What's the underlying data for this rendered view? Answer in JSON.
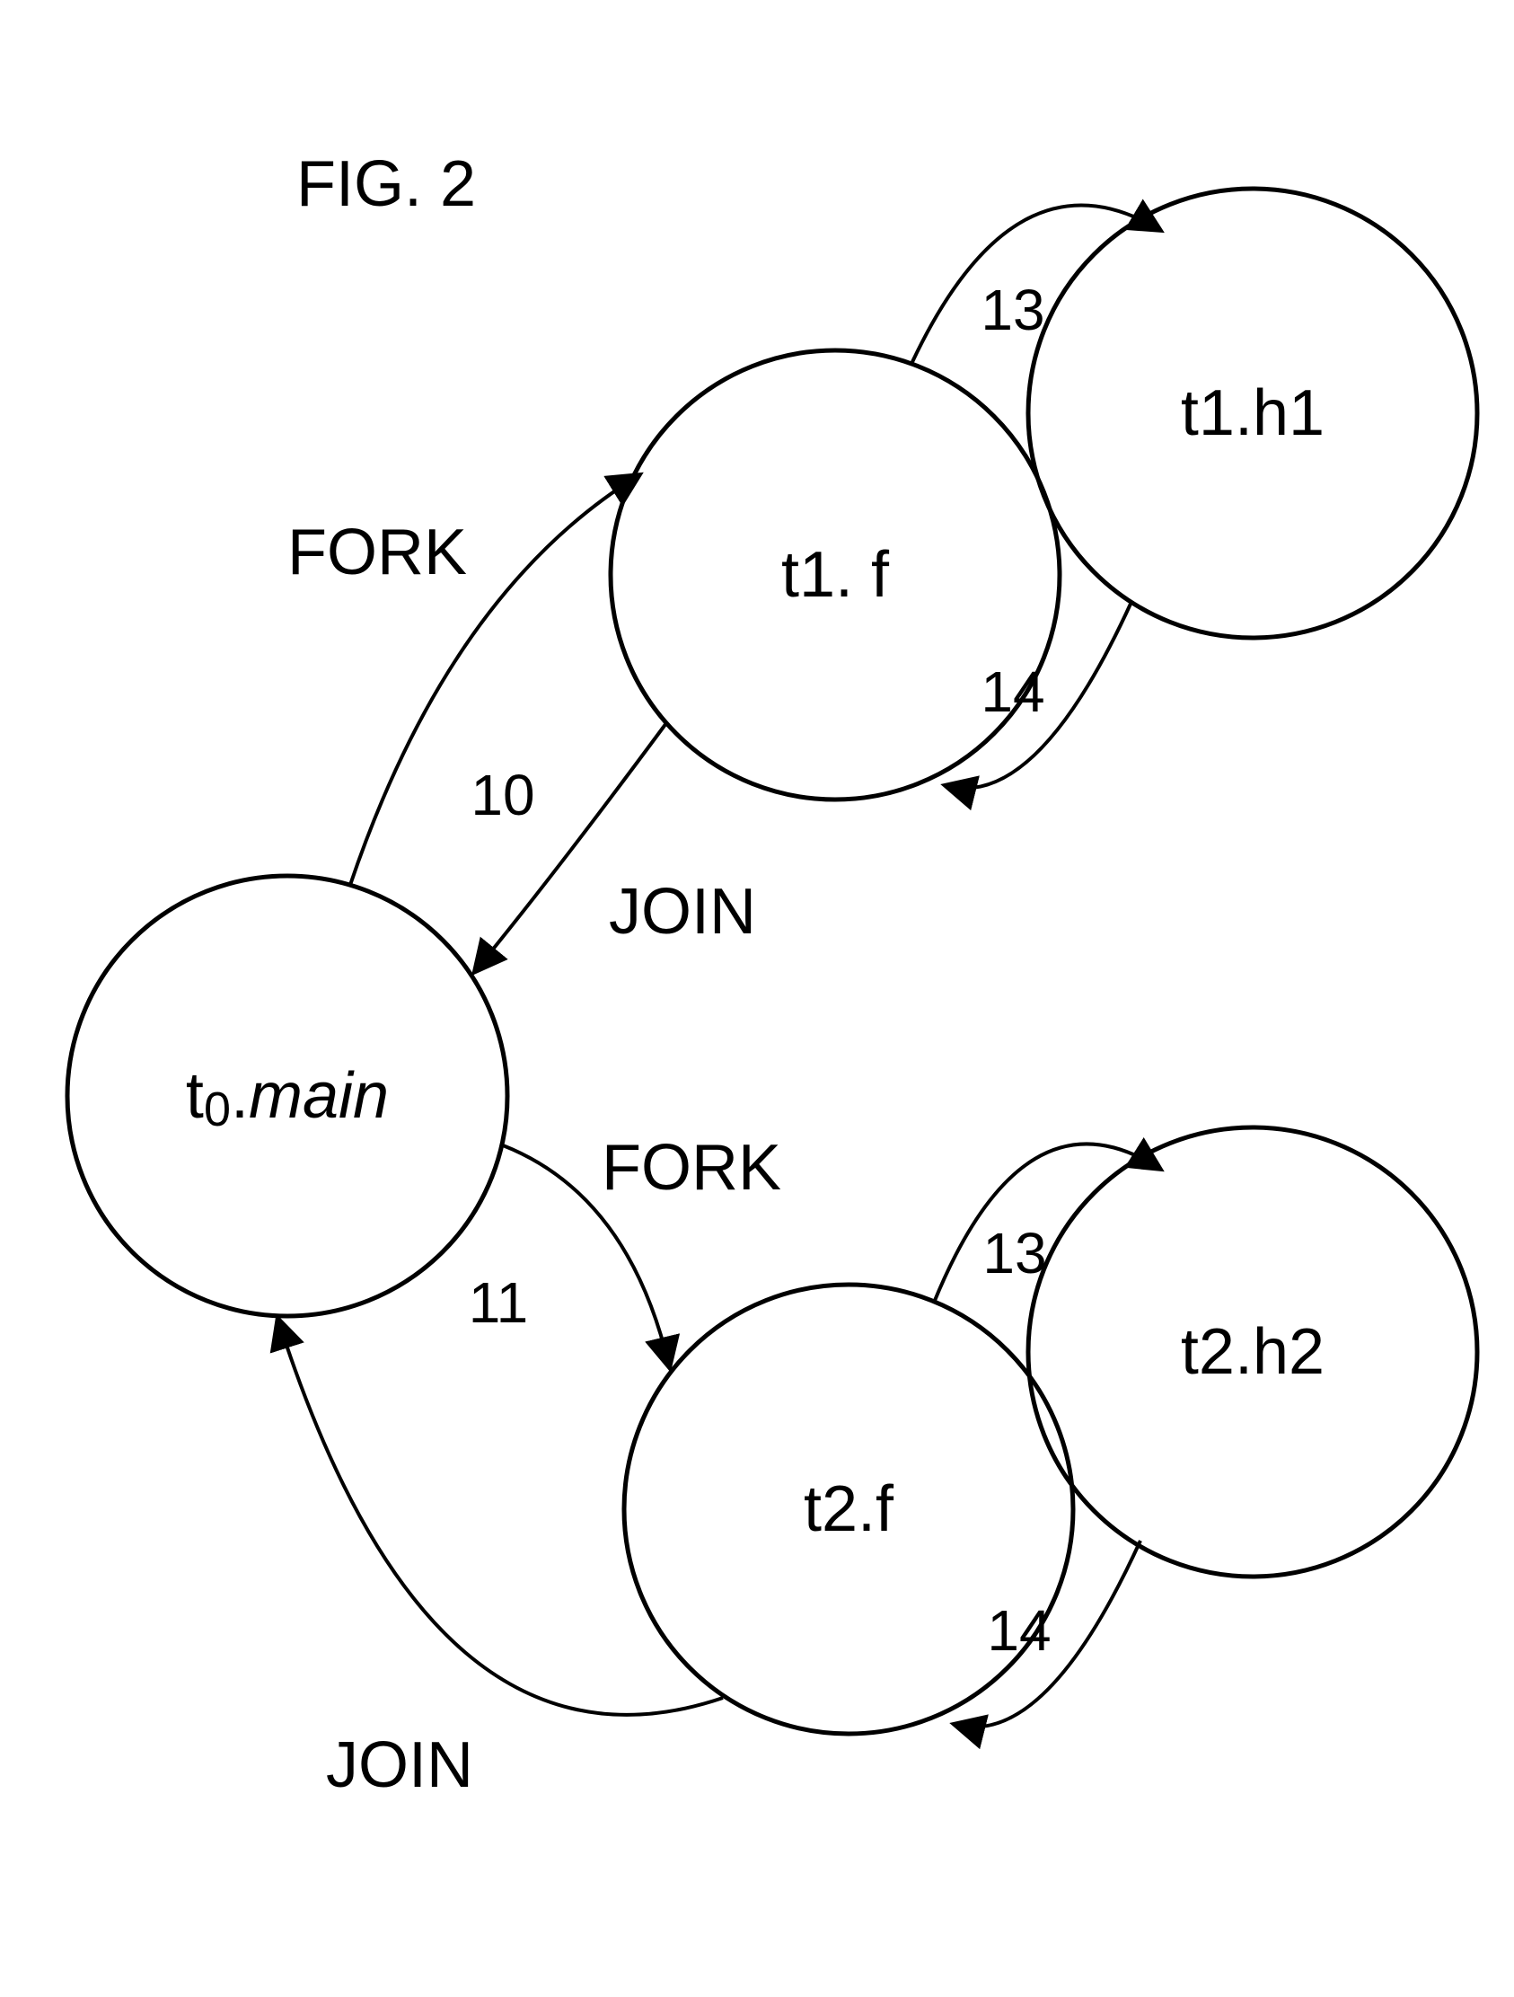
{
  "title": "FIG. 2",
  "nodes": {
    "n0": "t0.main",
    "n1": "t1. f",
    "n2": "t1.h1",
    "n3": "t2.f",
    "n4": "t2.h2"
  },
  "edges": {
    "e01_label": "10",
    "e03_label": "11",
    "e01_word": "FORK",
    "e10_word": "JOIN",
    "e03_word": "FORK",
    "e30_word": "JOIN",
    "e12_label": "13",
    "e21_label": "14",
    "e34_label": "13",
    "e43_label": "14"
  }
}
